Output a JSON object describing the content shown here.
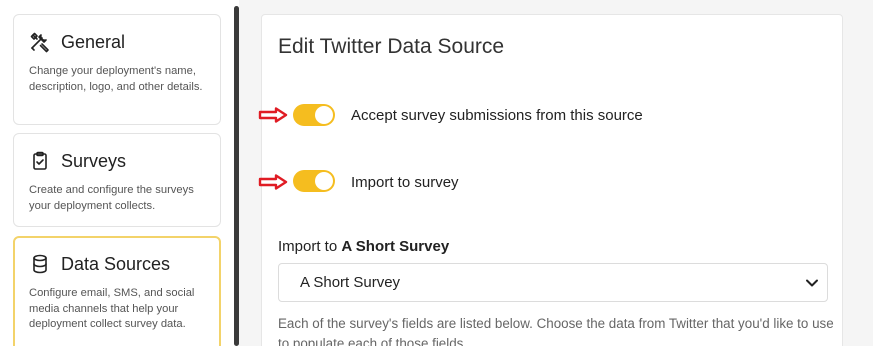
{
  "sidebar": {
    "items": [
      {
        "title": "General",
        "description": "Change your deployment's name, description, logo, and other details.",
        "icon": "tools-icon"
      },
      {
        "title": "Surveys",
        "description": "Create and configure the surveys your deployment collects.",
        "icon": "clipboard-check-icon"
      },
      {
        "title": "Data Sources",
        "description": "Configure email, SMS, and social media channels that help your deployment collect survey data.",
        "icon": "database-icon"
      }
    ]
  },
  "main": {
    "title": "Edit Twitter Data Source",
    "toggles": [
      {
        "label": "Accept survey submissions from this source",
        "on": true
      },
      {
        "label": "Import to survey",
        "on": true
      }
    ],
    "import_label_prefix": "Import to ",
    "import_label_survey": "A Short Survey",
    "select_value": "A Short Survey",
    "help_text": "Each of the survey's fields are listed below. Choose the data from Twitter that you'd like to use to populate each of those fields."
  },
  "colors": {
    "accent": "#f5bd1f",
    "selected_border": "#f3d36a",
    "arrow": "#e01c24"
  }
}
